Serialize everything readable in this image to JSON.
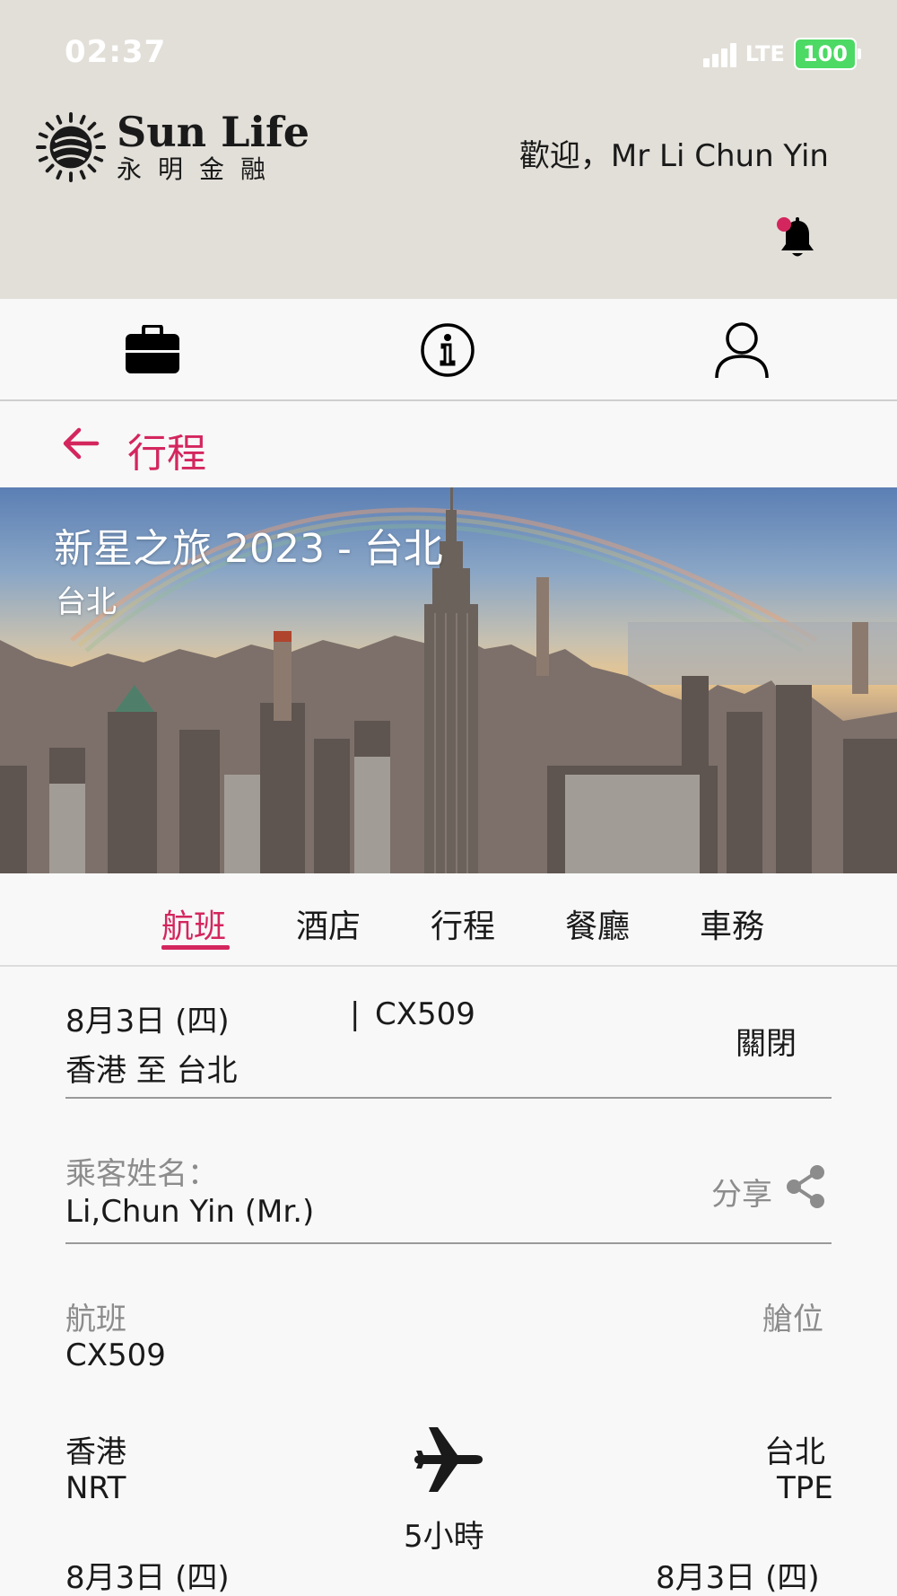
{
  "status_bar": {
    "time": "02:37",
    "network": "LTE",
    "battery": "100"
  },
  "header": {
    "logo_en": "Sun Life",
    "logo_zh": "永明金融",
    "welcome": "歡迎，Mr Li Chun Yin"
  },
  "page": {
    "title": "行程"
  },
  "hero": {
    "title": "新星之旅 2023 - 台北",
    "subtitle": "台北"
  },
  "tabs": [
    {
      "label": "航班"
    },
    {
      "label": "酒店"
    },
    {
      "label": "行程"
    },
    {
      "label": "餐廳"
    },
    {
      "label": "車務"
    }
  ],
  "flight_summary": {
    "date": "8月3日 (四)",
    "separator": "|",
    "flight_no": "CX509",
    "route": "香港 至 台北",
    "close_label": "關閉"
  },
  "passenger": {
    "label": "乘客姓名：",
    "name": "Li,Chun Yin (Mr.)",
    "share_label": "分享"
  },
  "flight_detail": {
    "flight_label": "航班",
    "flight_value": "CX509",
    "cabin_label": "艙位",
    "origin_city": "香港",
    "origin_code": "NRT",
    "dest_city": "台北",
    "dest_code": "TPE",
    "duration": "5小時",
    "depart_date": "8月3日 (四)",
    "arrive_date": "8月3日 (四)"
  },
  "colors": {
    "accent": "#d4265e",
    "header_bg": "#e2dfd8",
    "page_bg": "#f8f8f8"
  },
  "icons": [
    "briefcase-icon",
    "info-icon",
    "user-icon",
    "bell-icon",
    "back-arrow-icon",
    "share-icon",
    "airplane-icon"
  ]
}
